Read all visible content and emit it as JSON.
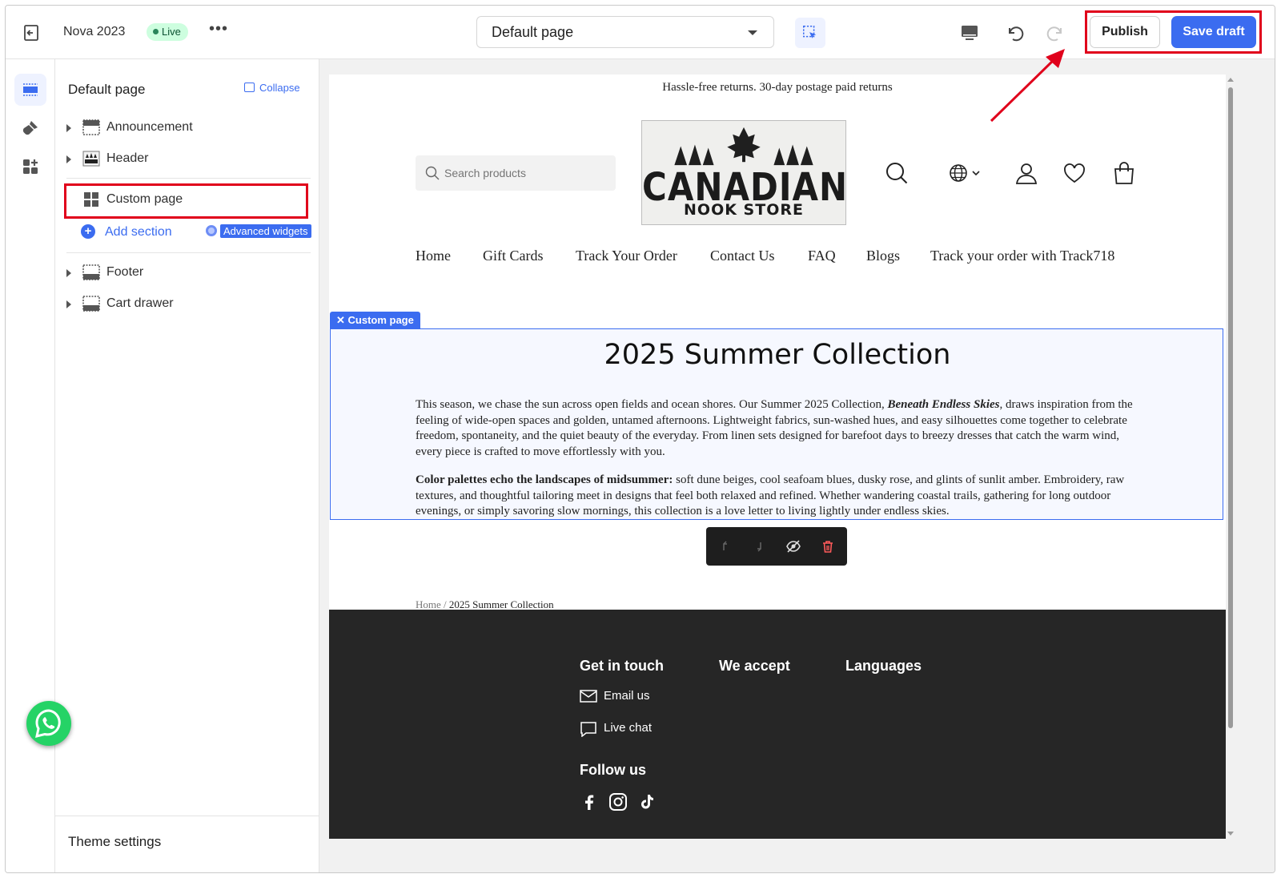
{
  "topbar": {
    "app_name": "Nova 2023",
    "status_badge": "Live",
    "more_glyph": "•••",
    "page_select": "Default page",
    "publish_label": "Publish",
    "save_label": "Save draft"
  },
  "sidebar": {
    "title": "Default page",
    "collapse_label": "Collapse",
    "sections": [
      {
        "label": "Announcement",
        "icon": "section-icon"
      },
      {
        "label": "Header",
        "icon": "header-thumbnail-icon"
      },
      {
        "label": "Custom page",
        "icon": "grid-icon"
      },
      {
        "label": "Footer",
        "icon": "section-icon"
      },
      {
        "label": "Cart drawer",
        "icon": "section-icon"
      }
    ],
    "add_section_label": "Add section",
    "advanced_widgets_label": "Advanced widgets",
    "theme_settings_label": "Theme settings"
  },
  "preview": {
    "announcement": "Hassle-free returns. 30-day postage paid returns",
    "search_placeholder": "Search products",
    "logo": {
      "line1": "CANADIAN",
      "line2": "NOOK STORE"
    },
    "nav": [
      "Home",
      "Gift Cards",
      "Track Your Order",
      "Contact Us",
      "FAQ",
      "Blogs",
      "Track your order with Track718"
    ],
    "custom_page_tag": "Custom page",
    "title": "2025 Summer Collection",
    "p1_before": "This season, we chase the sun across open fields and ocean shores. Our Summer 2025 Collection, ",
    "p1_bold": "Beneath Endless Skies",
    "p1_after": ", draws inspiration from the feeling of wide-open spaces and golden, untamed afternoons. Lightweight fabrics, sun-washed hues, and easy silhouettes come together to celebrate freedom, spontaneity, and the quiet beauty of the everyday. From linen sets designed for barefoot days to breezy dresses that catch the warm wind, every piece is crafted to move effortlessly with you.",
    "p2_bold": "Color palettes echo the landscapes of midsummer:",
    "p2_after": " soft dune beiges, cool seafoam blues, dusky rose, and glints of sunlit amber. Embroidery, raw textures, and thoughtful tailoring meet in designs that feel both relaxed and refined. Whether wandering coastal trails, gathering for long outdoor evenings, or simply savoring slow mornings, this collection is a love letter to living lightly under endless skies.",
    "breadcrumb_home": "Home",
    "breadcrumb_sep": " / ",
    "breadcrumb_current": "2025 Summer Collection",
    "footer": {
      "get_in_touch": "Get in touch",
      "we_accept": "We accept",
      "languages": "Languages",
      "email": "Email us",
      "chat": "Live chat",
      "follow": "Follow us"
    }
  },
  "colors": {
    "accent": "#3b6cf0",
    "highlight": "#e0001b",
    "live_bg": "#cdfedf",
    "footer_bg": "#262626",
    "whatsapp": "#25d366"
  }
}
